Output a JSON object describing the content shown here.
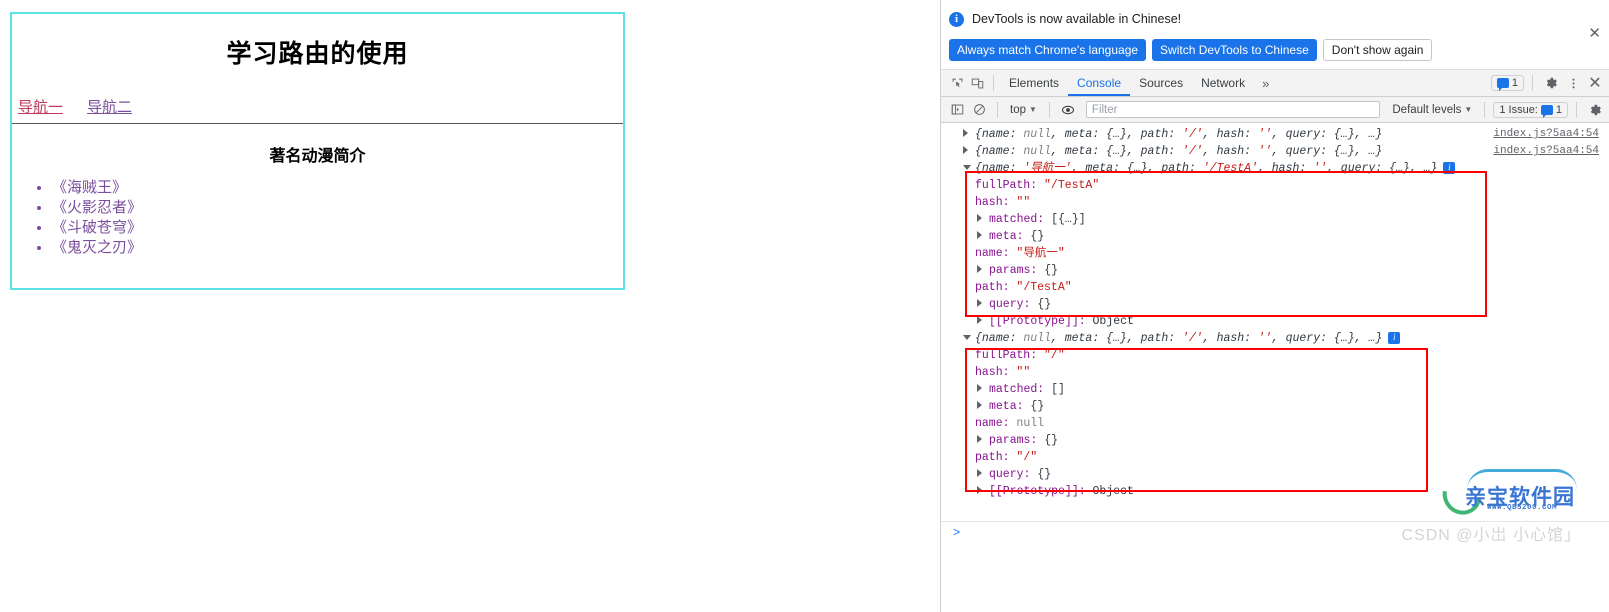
{
  "webpage": {
    "title": "学习路由的使用",
    "nav": [
      {
        "label": "导航一",
        "state": "active"
      },
      {
        "label": "导航二",
        "state": "visited"
      }
    ],
    "section_title": "著名动漫简介",
    "anime_list": [
      "《海贼王》",
      "《火影忍者》",
      "《斗破苍穹》",
      "《鬼灭之刃》"
    ],
    "border_color": "#5ce1e6",
    "active_link_color": "#c0385c",
    "visited_link_color": "#7c4f9e"
  },
  "devtools": {
    "banner": {
      "icon": "info-icon",
      "message": "DevTools is now available in Chinese!",
      "buttons": [
        {
          "label": "Always match Chrome's language",
          "style": "primary"
        },
        {
          "label": "Switch DevTools to Chinese",
          "style": "primary"
        },
        {
          "label": "Don't show again",
          "style": "plain"
        }
      ],
      "close_label": "✕",
      "accent_color": "#1a73e8"
    },
    "tabstrip": {
      "left_icons": [
        "inspect-element-icon",
        "device-toolbar-icon"
      ],
      "tabs": [
        {
          "label": "Elements",
          "selected": false
        },
        {
          "label": "Console",
          "selected": true
        },
        {
          "label": "Sources",
          "selected": false
        },
        {
          "label": "Network",
          "selected": false
        }
      ],
      "more_label": "»",
      "message_count": "1",
      "settings_label": "settings-gear-icon",
      "more_options_label": "more-vertical-icon",
      "close_label": "✕"
    },
    "filterbar": {
      "sidebar_toggle": "console-sidebar-icon",
      "clear_console": "clear-console-icon",
      "context": "top",
      "eye_icon": "live-expression-icon",
      "filter_placeholder": "Filter",
      "filter_value": "",
      "levels": "Default levels",
      "issues_label": "1 Issue:",
      "issues_count": "1",
      "settings_icon": "settings-gear-icon"
    },
    "console": {
      "source_link": "index.js?5aa4:54",
      "prompt_symbol": ">",
      "rows": [
        {
          "kind": "collapsed",
          "preview_parts": [
            {
              "t": "{name: ",
              "c": "obj"
            },
            {
              "t": "null",
              "c": "null"
            },
            {
              "t": ", meta: {…}, path: ",
              "c": "obj"
            },
            {
              "t": "'/'",
              "c": "str"
            },
            {
              "t": ", hash: ",
              "c": "obj"
            },
            {
              "t": "''",
              "c": "str"
            },
            {
              "t": ", query: {…}, …}",
              "c": "obj"
            }
          ],
          "source": "index.js?5aa4:54"
        },
        {
          "kind": "collapsed",
          "preview_parts": [
            {
              "t": "{name: ",
              "c": "obj"
            },
            {
              "t": "null",
              "c": "null"
            },
            {
              "t": ", meta: {…}, path: ",
              "c": "obj"
            },
            {
              "t": "'/'",
              "c": "str"
            },
            {
              "t": ", hash: ",
              "c": "obj"
            },
            {
              "t": "''",
              "c": "str"
            },
            {
              "t": ", query: {…}, …}",
              "c": "obj"
            }
          ],
          "source": ""
        },
        {
          "kind": "expanded",
          "source": "index.js?5aa4:54",
          "preview_parts": [
            {
              "t": "{name: ",
              "c": "obj"
            },
            {
              "t": "'导航一'",
              "c": "str"
            },
            {
              "t": ", meta: {…}, path: ",
              "c": "obj"
            },
            {
              "t": "'/TestA'",
              "c": "str"
            },
            {
              "t": ", hash: ",
              "c": "obj"
            },
            {
              "t": "''",
              "c": "str"
            },
            {
              "t": ", query: {…}, …}",
              "c": "obj"
            }
          ],
          "has_info_badge": true,
          "props": [
            {
              "twisty": false,
              "name": "fullPath",
              "value": "\"/TestA\"",
              "vtype": "str"
            },
            {
              "twisty": false,
              "name": "hash",
              "value": "\"\"",
              "vtype": "str"
            },
            {
              "twisty": true,
              "name": "matched",
              "value": "[{…}]",
              "vtype": "obj"
            },
            {
              "twisty": true,
              "name": "meta",
              "value": "{}",
              "vtype": "obj"
            },
            {
              "twisty": false,
              "name": "name",
              "value": "\"导航一\"",
              "vtype": "str"
            },
            {
              "twisty": true,
              "name": "params",
              "value": "{}",
              "vtype": "obj"
            },
            {
              "twisty": false,
              "name": "path",
              "value": "\"/TestA\"",
              "vtype": "str"
            },
            {
              "twisty": true,
              "name": "query",
              "value": "{}",
              "vtype": "obj"
            },
            {
              "twisty": true,
              "name": "[[Prototype]]",
              "value": "Object",
              "vtype": "plain"
            }
          ]
        },
        {
          "kind": "expanded",
          "source": "",
          "preview_parts": [
            {
              "t": "{name: ",
              "c": "obj"
            },
            {
              "t": "null",
              "c": "null"
            },
            {
              "t": ", meta: {…}, path: ",
              "c": "obj"
            },
            {
              "t": "'/'",
              "c": "str"
            },
            {
              "t": ", hash: ",
              "c": "obj"
            },
            {
              "t": "''",
              "c": "str"
            },
            {
              "t": ", query: {…}, …}",
              "c": "obj"
            }
          ],
          "has_info_badge": true,
          "props": [
            {
              "twisty": false,
              "name": "fullPath",
              "value": "\"/\"",
              "vtype": "str"
            },
            {
              "twisty": false,
              "name": "hash",
              "value": "\"\"",
              "vtype": "str"
            },
            {
              "twisty": true,
              "name": "matched",
              "value": "[]",
              "vtype": "obj"
            },
            {
              "twisty": true,
              "name": "meta",
              "value": "{}",
              "vtype": "obj"
            },
            {
              "twisty": false,
              "name": "name",
              "value": "null",
              "vtype": "null"
            },
            {
              "twisty": true,
              "name": "params",
              "value": "{}",
              "vtype": "obj"
            },
            {
              "twisty": false,
              "name": "path",
              "value": "\"/\"",
              "vtype": "str"
            },
            {
              "twisty": true,
              "name": "query",
              "value": "{}",
              "vtype": "obj"
            },
            {
              "twisty": true,
              "name": "[[Prototype]]",
              "value": "Object",
              "vtype": "plain"
            }
          ]
        }
      ]
    },
    "watermark": {
      "logo_text": "亲宝软件园",
      "logo_url": "WWW.QB5200.COM",
      "csdn_text": "CSDN @小岀  小心馆」"
    }
  }
}
